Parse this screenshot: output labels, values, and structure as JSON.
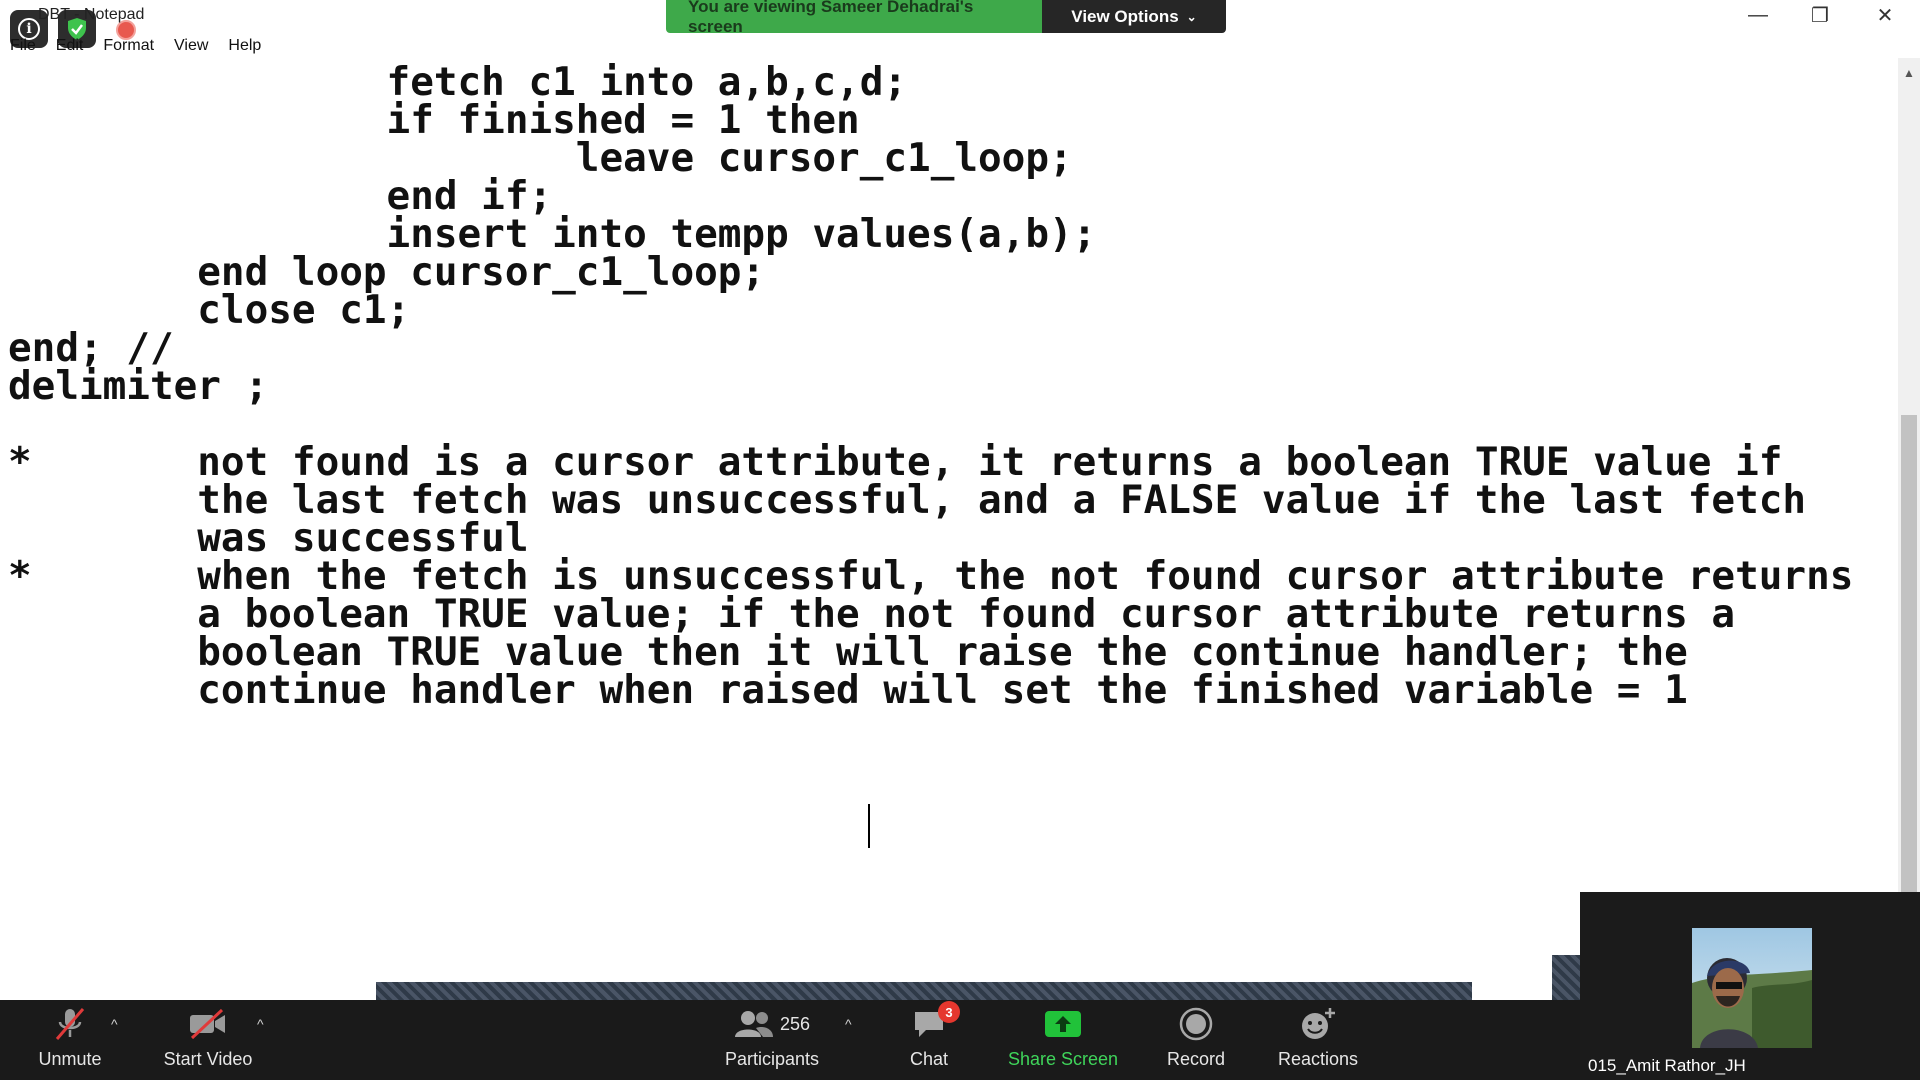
{
  "app": {
    "title": "DBT - Notepad",
    "menu": [
      "File",
      "Edit",
      "Format",
      "View",
      "Help"
    ]
  },
  "share_banner": {
    "viewing_text": "You are viewing Sameer Dehadrai's screen",
    "view_options_label": "View Options",
    "accent_color": "#3ea94a"
  },
  "window_controls": {
    "minimize": "—",
    "restore": "❐",
    "close": "✕"
  },
  "editor": {
    "lines": [
      "                fetch c1 into a,b,c,d;",
      "                if finished = 1 then",
      "                        leave cursor_c1_loop;",
      "                end if;",
      "                insert into tempp values(a,b);",
      "        end loop cursor_c1_loop;",
      "        close c1;",
      "end; //",
      "delimiter ;",
      "",
      "*       not found is a cursor attribute, it returns a boolean TRUE value if",
      "        the last fetch was unsuccessful, and a FALSE value if the last fetch",
      "        was successful",
      "*       when the fetch is unsuccessful, the not found cursor attribute returns",
      "        a boolean TRUE value; if the not found cursor attribute returns a",
      "        boolean TRUE value then it will raise the continue handler; the",
      "        continue handler when raised will set the finished variable = 1"
    ]
  },
  "toolbar": {
    "unmute_label": "Unmute",
    "start_video_label": "Start Video",
    "participants_label": "Participants",
    "participants_count": "256",
    "chat_label": "Chat",
    "chat_badge": "3",
    "share_screen_label": "Share Screen",
    "record_label": "Record",
    "reactions_label": "Reactions"
  },
  "video_tile": {
    "participant_name": "015_Amit Rathor_JH"
  }
}
